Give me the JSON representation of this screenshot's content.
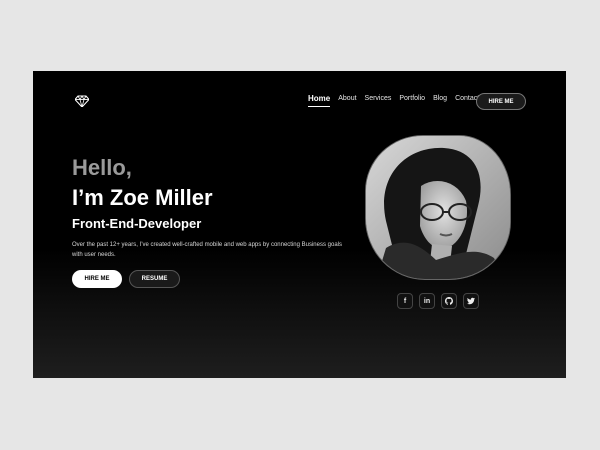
{
  "nav": {
    "items": [
      {
        "label": "Home",
        "active": true
      },
      {
        "label": "About",
        "active": false
      },
      {
        "label": "Services",
        "active": false
      },
      {
        "label": "Portfolio",
        "active": false
      },
      {
        "label": "Blog",
        "active": false
      },
      {
        "label": "Contact",
        "active": false
      }
    ],
    "cta": "HIRE ME"
  },
  "hero": {
    "greeting": "Hello,",
    "name": "I’m Zoe Miller",
    "role": "Front-End-Developer",
    "description": "Over the past 12+ years, I’ve created well-crafted mobile and web apps by connecting Business goals with user needs.",
    "primary_button": "HIRE ME",
    "secondary_button": "RESUME"
  },
  "social": {
    "facebook": "f",
    "linkedin": "in",
    "icons": [
      "facebook-icon",
      "linkedin-icon",
      "github-icon",
      "twitter-icon"
    ]
  },
  "colors": {
    "background": "#000000",
    "page": "#e6e6e6",
    "muted_heading": "#9a9a9a",
    "text": "#ffffff"
  }
}
